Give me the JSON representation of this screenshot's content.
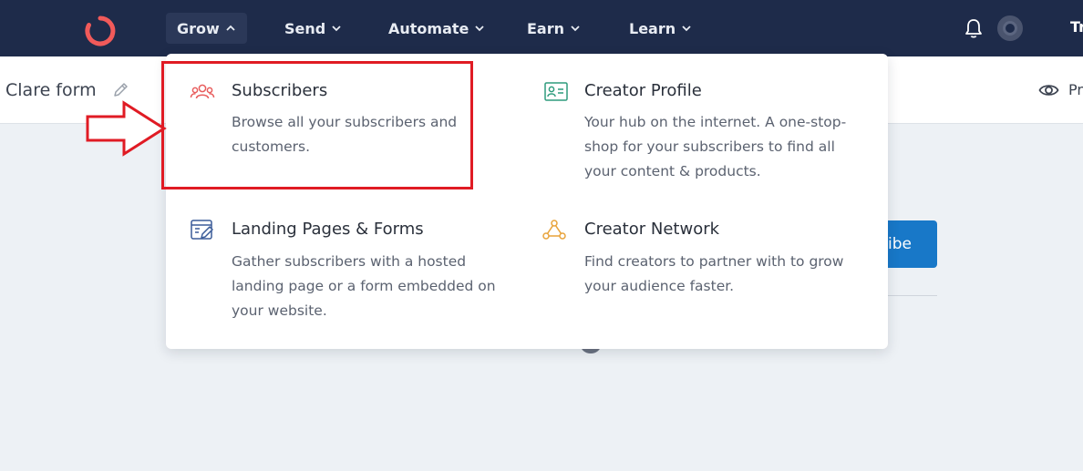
{
  "topbar": {
    "nav": [
      {
        "label": "Grow",
        "active": true
      },
      {
        "label": "Send"
      },
      {
        "label": "Automate"
      },
      {
        "label": "Earn"
      },
      {
        "label": "Learn"
      }
    ],
    "trunc_label": "Tr"
  },
  "subbar": {
    "form_title": "Clare form",
    "preview_trunc": "Pr"
  },
  "page": {
    "subscribe_trunc": "ibe"
  },
  "grow_menu": {
    "items": [
      {
        "title": "Subscribers",
        "description": "Browse all your subscribers and customers.",
        "icon": "users-icon"
      },
      {
        "title": "Creator Profile",
        "description": "Your hub on the internet. A one-stop-shop for your subscribers to find all your content & products.",
        "icon": "profile-card-icon"
      },
      {
        "title": "Landing Pages & Forms",
        "description": "Gather subscribers with a hosted landing page or a form embedded on your website.",
        "icon": "landing-page-icon"
      },
      {
        "title": "Creator Network",
        "description": "Find creators to partner with to grow your audience faster.",
        "icon": "network-icon"
      }
    ]
  },
  "colors": {
    "topbar_bg": "#1e2b4a",
    "brand": "#f15a5a",
    "annotation_red": "#e01b24",
    "button_blue": "#1878c8"
  }
}
